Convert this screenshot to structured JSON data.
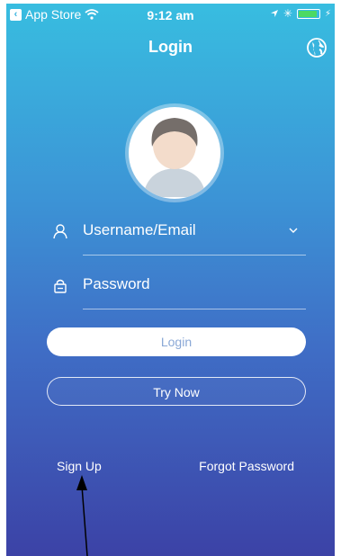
{
  "status_bar": {
    "back_app": "App Store",
    "time": "9:12 am"
  },
  "header": {
    "title": "Login"
  },
  "form": {
    "username_label": "Username/Email",
    "password_label": "Password",
    "login_label": "Login",
    "try_now_label": "Try Now"
  },
  "footer": {
    "sign_up_label": "Sign Up",
    "forgot_password_label": "Forgot Password"
  },
  "colors": {
    "gradient_top": "#38bde0",
    "gradient_bottom": "#3c42a6",
    "battery": "#4cd964"
  },
  "icons": [
    "back-icon",
    "wifi-icon",
    "location-icon",
    "bluetooth-icon",
    "battery-icon",
    "globe-icon",
    "avatar-icon",
    "user-icon",
    "lock-icon",
    "chevron-down-icon",
    "annotation-arrow"
  ]
}
